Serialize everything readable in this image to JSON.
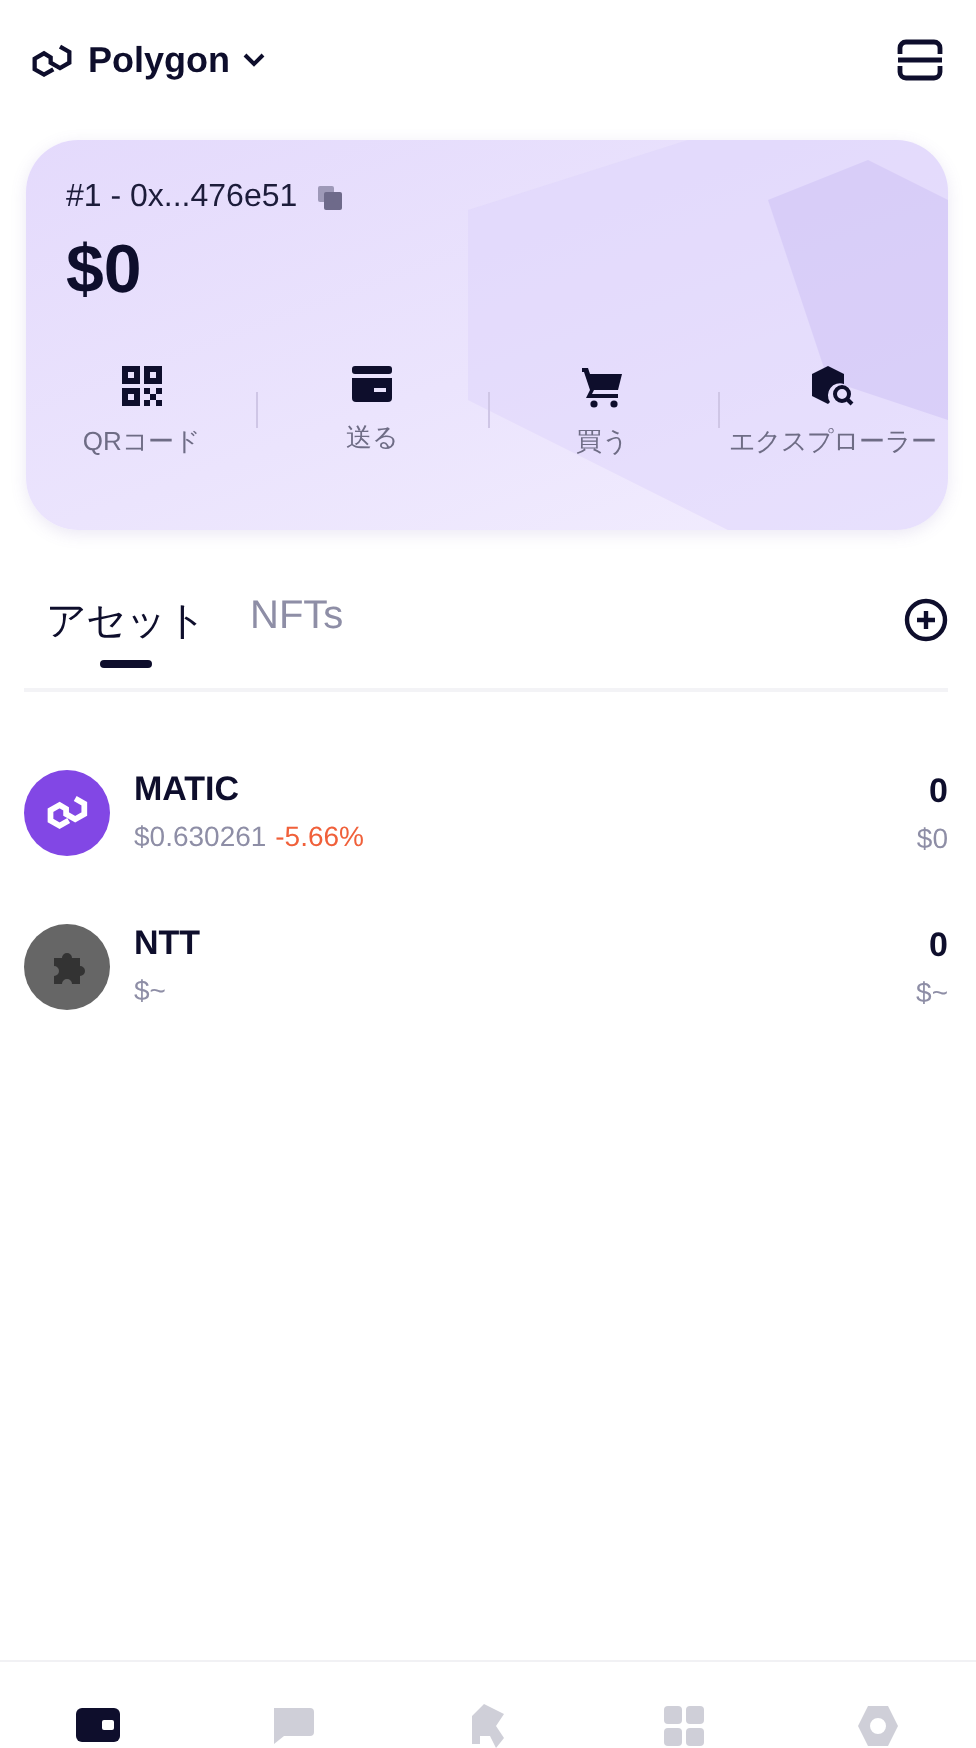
{
  "header": {
    "network": "Polygon"
  },
  "account": {
    "address": "#1 - 0x...476e51",
    "balance": "$0"
  },
  "actions": [
    {
      "kind": "qr",
      "label": "QRコード"
    },
    {
      "kind": "send",
      "label": "送る"
    },
    {
      "kind": "buy",
      "label": "買う"
    },
    {
      "kind": "explorer",
      "label": "エクスプローラー"
    }
  ],
  "tabs": [
    {
      "label": "アセット",
      "selected": true
    },
    {
      "label": "NFTs",
      "selected": false
    }
  ],
  "assets": [
    {
      "kind": "matic",
      "name": "MATIC",
      "price": "$0.630261",
      "change": "-5.66%",
      "amount": "0",
      "value": "$0"
    },
    {
      "kind": "generic",
      "name": "NTT",
      "price": "$~",
      "amount": "0",
      "value": "$~"
    }
  ],
  "nav": [
    {
      "kind": "wallet",
      "selected": true
    },
    {
      "kind": "chat",
      "selected": false
    },
    {
      "kind": "logo",
      "selected": false
    },
    {
      "kind": "apps",
      "selected": false
    },
    {
      "kind": "settings",
      "selected": false
    }
  ]
}
